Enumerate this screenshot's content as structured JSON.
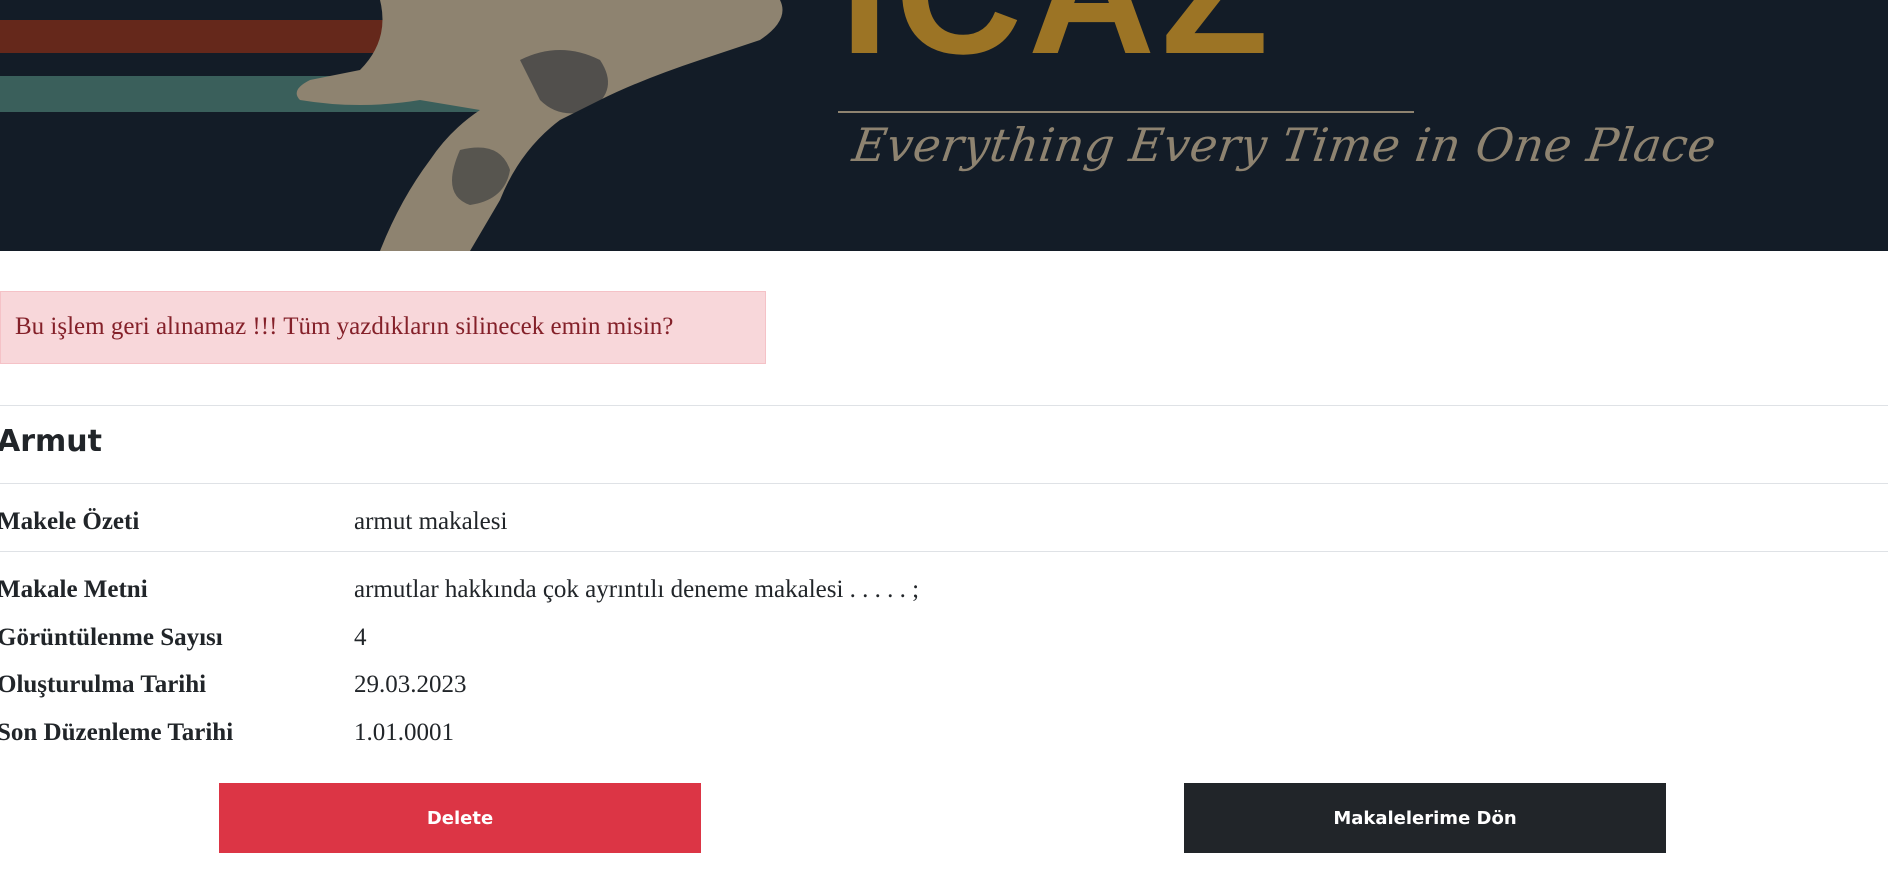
{
  "banner": {
    "title": "ICAZ",
    "tagline": "Everything Every Time in One Place",
    "colors": {
      "background": "#131c27",
      "title": "#9c7425",
      "tagline": "#8e8370",
      "stripe_red": "#65281b",
      "stripe_teal": "#3a5f5b"
    }
  },
  "alert": {
    "message": "Bu işlem geri alınamaz !!! Tüm yazdıkların silinecek emin misin?"
  },
  "article": {
    "title": "Armut",
    "fields": [
      {
        "label": "Makele Özeti",
        "value": "armut makalesi"
      },
      {
        "label": "Makale Metni",
        "value": "armutlar hakkında çok ayrıntılı deneme makalesi . . . . . ;"
      },
      {
        "label": "Görüntülenme Sayısı",
        "value": "4"
      },
      {
        "label": "Oluşturulma Tarihi",
        "value": "29.03.2023"
      },
      {
        "label": "Son Düzenleme Tarihi",
        "value": "1.01.0001"
      }
    ]
  },
  "actions": {
    "delete_label": "Delete",
    "back_label": "Makalelerime Dön",
    "colors": {
      "delete": "#dc3545",
      "back": "#212529"
    }
  }
}
